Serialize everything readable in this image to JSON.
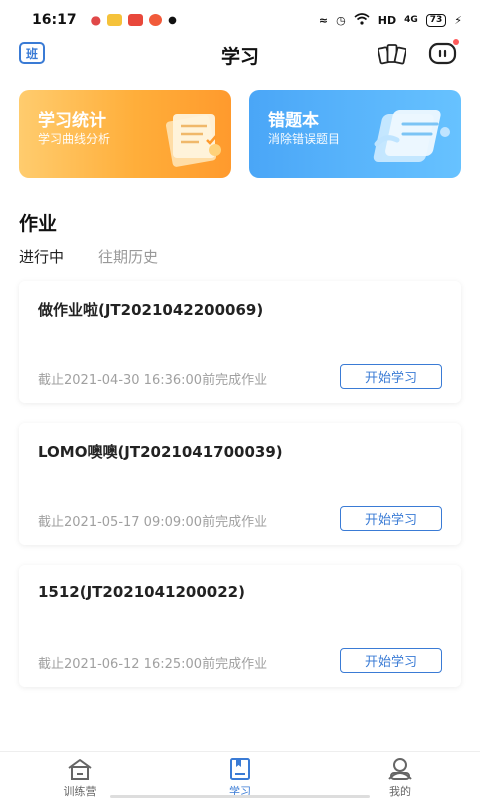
{
  "status_bar": {
    "time": "16:17",
    "network": "HD",
    "signal": "4G",
    "battery": "73"
  },
  "header": {
    "class_badge": "班",
    "title": "学习"
  },
  "feature_cards": [
    {
      "title": "学习统计",
      "subtitle": "学习曲线分析"
    },
    {
      "title": "错题本",
      "subtitle": "消除错误题目"
    }
  ],
  "homework": {
    "section_title": "作业",
    "tabs": [
      {
        "label": "进行中",
        "active": true
      },
      {
        "label": "往期历史",
        "active": false
      }
    ],
    "items": [
      {
        "title": "做作业啦(JT2021042200069)",
        "deadline": "截止2021-04-30 16:36:00前完成作业",
        "button": "开始学习"
      },
      {
        "title": "LOMO噢噢(JT2021041700039)",
        "deadline": "截止2021-05-17 09:09:00前完成作业",
        "button": "开始学习"
      },
      {
        "title": "1512(JT2021041200022)",
        "deadline": "截止2021-06-12 16:25:00前完成作业",
        "button": "开始学习"
      }
    ]
  },
  "bottom_nav": [
    {
      "label": "训练营",
      "icon": "house-icon",
      "active": false
    },
    {
      "label": "学习",
      "icon": "book-icon",
      "active": true
    },
    {
      "label": "我的",
      "icon": "person-icon",
      "active": false
    }
  ],
  "colors": {
    "accent": "#3a7bd5",
    "stats_card": "#ffae3a",
    "wrong_card": "#4aa6f7"
  }
}
